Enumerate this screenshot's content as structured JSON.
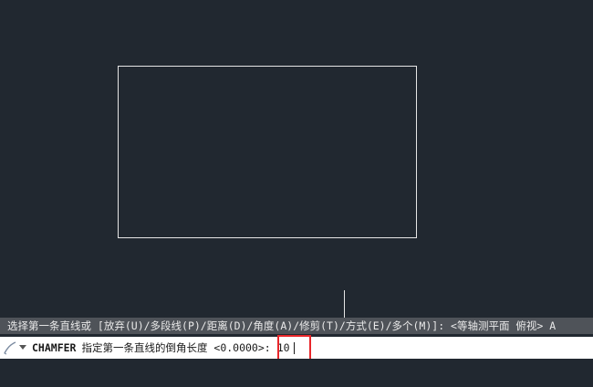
{
  "history": {
    "text": "选择第一条直线或 [放弃(U)/多段线(P)/距离(D)/角度(A)/修剪(T)/方式(E)/多个(M)]: <等轴测平面 俯视> A"
  },
  "command_line": {
    "command_name": "CHAMFER",
    "prompt": "指定第一条直线的倒角长度 <0.0000>:",
    "input_value": "10"
  },
  "icons": {
    "command": "command-prompt-icon",
    "dropdown": "chevron-down-icon"
  },
  "colors": {
    "canvas_bg": "#212830",
    "history_bg": "#4f5359",
    "highlight": "#e8262a"
  }
}
